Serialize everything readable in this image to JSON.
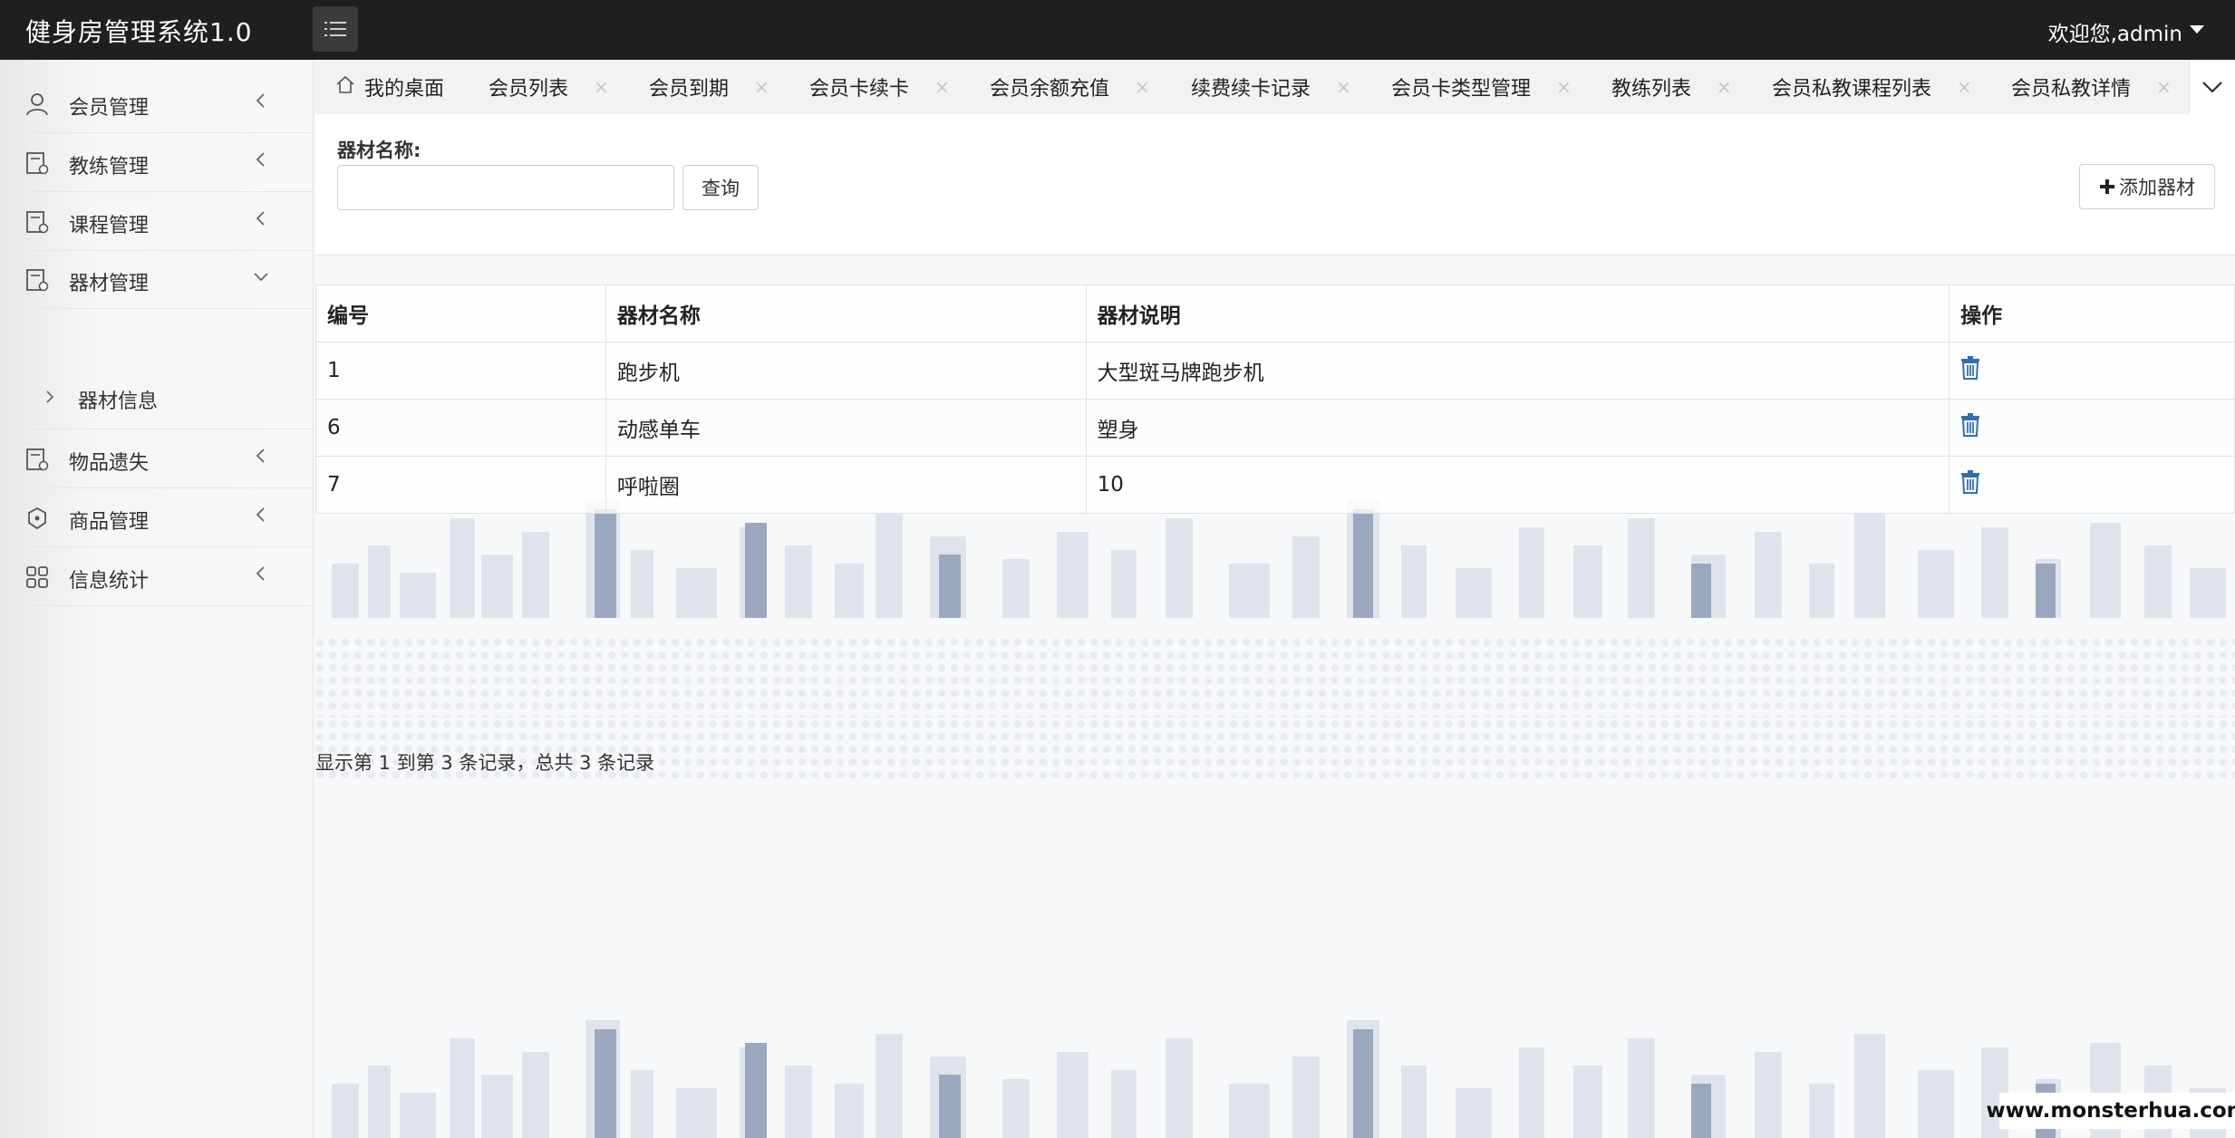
{
  "header": {
    "title": "健身房管理系统1.0",
    "user_greeting": "欢迎您,admin"
  },
  "sidebar": {
    "items": [
      {
        "label": "会员管理",
        "icon": "user-icon"
      },
      {
        "label": "教练管理",
        "icon": "file-icon"
      },
      {
        "label": "课程管理",
        "icon": "file-icon"
      },
      {
        "label": "器材管理",
        "icon": "file-icon",
        "expanded": true
      },
      {
        "label": "物品遗失",
        "icon": "file-icon"
      },
      {
        "label": "商品管理",
        "icon": "cycle-icon"
      },
      {
        "label": "信息统计",
        "icon": "grid-icon"
      }
    ],
    "sub_items": [
      {
        "label": "器材信息"
      }
    ]
  },
  "tabs": [
    {
      "label": "我的桌面",
      "icon": "home-icon"
    },
    {
      "label": "会员列表",
      "close": "×"
    },
    {
      "label": "会员到期",
      "close": "×"
    },
    {
      "label": "会员卡续卡",
      "close": "×"
    },
    {
      "label": "会员余额充值",
      "close": "×"
    },
    {
      "label": "续费续卡记录",
      "close": "×"
    },
    {
      "label": "会员卡类型管理",
      "close": "×"
    },
    {
      "label": "教练列表",
      "close": "×"
    },
    {
      "label": "会员私教课程列表",
      "close": "×"
    },
    {
      "label": "会员私教详情",
      "close": "×"
    }
  ],
  "search": {
    "label": "器材名称:",
    "value": "",
    "placeholder": "",
    "query_button": "查询",
    "add_button": "添加器材"
  },
  "table": {
    "columns": [
      "编号",
      "器材名称",
      "器材说明",
      "操作"
    ],
    "rows": [
      {
        "id": "1",
        "name": "跑步机",
        "description": "大型斑马牌跑步机"
      },
      {
        "id": "6",
        "name": "动感单车",
        "description": "塑身"
      },
      {
        "id": "7",
        "name": "呼啦圈",
        "description": "10"
      }
    ]
  },
  "pagination": {
    "info": "显示第 1 到第 3 条记录，总共 3 条记录"
  },
  "watermark": {
    "site": "www.monsterhua.com"
  },
  "colors": {
    "header_bg": "#1f1f1f",
    "sidebar_bg": "#f6f6f6",
    "trash_icon": "#2f6fb5"
  }
}
